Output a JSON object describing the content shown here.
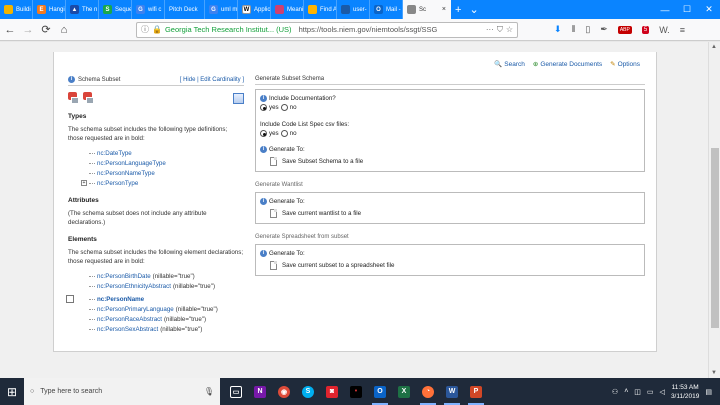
{
  "browser": {
    "tabs": [
      {
        "label": "Buildi",
        "color": "#f2b400",
        "glyph": ""
      },
      {
        "label": "Hangi",
        "color": "#f47a20",
        "glyph": "E"
      },
      {
        "label": "The n",
        "color": "#1a4aa8",
        "glyph": "▲"
      },
      {
        "label": "Seque",
        "color": "#1aa84a",
        "glyph": "S"
      },
      {
        "label": "wifi c",
        "color": "#3d82f0",
        "glyph": "G"
      },
      {
        "label": "Pitch Deck",
        "color": "",
        "glyph": ""
      },
      {
        "label": "uml m",
        "color": "#3d82f0",
        "glyph": "G"
      },
      {
        "label": "Applic",
        "color": "#ffffff",
        "glyph": "W"
      },
      {
        "label": "Meani",
        "color": "#d04070",
        "glyph": ""
      },
      {
        "label": "Find A",
        "color": "#ffb400",
        "glyph": ""
      },
      {
        "label": "user-",
        "color": "#1a5aa8",
        "glyph": ""
      },
      {
        "label": "Mail -",
        "color": "#0a64c8",
        "glyph": "O"
      },
      {
        "label": "Sc",
        "color": "#888888",
        "glyph": ""
      }
    ],
    "new_tab": "+",
    "tab_menu": "⌄",
    "win_min": "—",
    "win_max": "☐",
    "win_close": "✕",
    "back": "←",
    "forward": "→",
    "reload": "⟳",
    "home": "⌂",
    "url_org": "Georgia Tech Research Institut... (US)",
    "url": "https://tools.niem.gov/niemtools/ssgt/SSG",
    "url_more": "···",
    "bookmark_star": "☆"
  },
  "page": {
    "actions": [
      {
        "label": "Search",
        "icon": "🔍"
      },
      {
        "label": "Generate Documents",
        "icon": "⊕"
      },
      {
        "label": "Options",
        "icon": "✎"
      }
    ],
    "schema_subset": {
      "title": "Schema Subset",
      "links": "[ Hide | Edit Cardinality ]"
    },
    "types": {
      "title": "Types",
      "desc": "The schema subset includes the following type definitions; those requested are in bold:",
      "items": [
        "nc:DateType",
        "nc:PersonLanguageType",
        "nc:PersonNameType",
        "nc:PersonType"
      ]
    },
    "attributes": {
      "title": "Attributes",
      "desc": "(The schema subset does not include any attribute declarations.)"
    },
    "elements": {
      "title": "Elements",
      "desc": "The schema subset includes the following element declarations; those requested are in bold:",
      "items": [
        {
          "name": "nc:PersonBirthDate",
          "extra": "(nillable=\"true\")"
        },
        {
          "name": "nc:PersonEthnicityAbstract",
          "extra": "(nillable=\"true\")"
        },
        {
          "name": "nc:PersonName",
          "extra": ""
        },
        {
          "name": "nc:PersonPrimaryLanguage",
          "extra": "(nillable=\"true\")"
        },
        {
          "name": "nc:PersonRaceAbstract",
          "extra": "(nillable=\"true\")"
        },
        {
          "name": "nc:PersonSexAbstract",
          "extra": "(nillable=\"true\")"
        }
      ]
    },
    "generate_schema": {
      "title": "Generate Subset Schema",
      "include_doc": "Include Documentation?",
      "include_csv": "Include Code List Spec csv files:",
      "yes": "yes",
      "no": "no",
      "generate_to": "Generate To:",
      "file": "Save Subset Schema to a file"
    },
    "wantlist": {
      "title": "Generate Wantlist",
      "generate_to": "Generate To:",
      "file": "Save current wantlist to a file"
    },
    "spreadsheet": {
      "title": "Generate Spreadsheet from subset",
      "generate_to": "Generate To:",
      "file": "Save current subset to a spreadsheet file"
    }
  },
  "taskbar": {
    "search_placeholder": "Type here to search",
    "time": "11:53 AM",
    "date": "3/11/2019"
  }
}
